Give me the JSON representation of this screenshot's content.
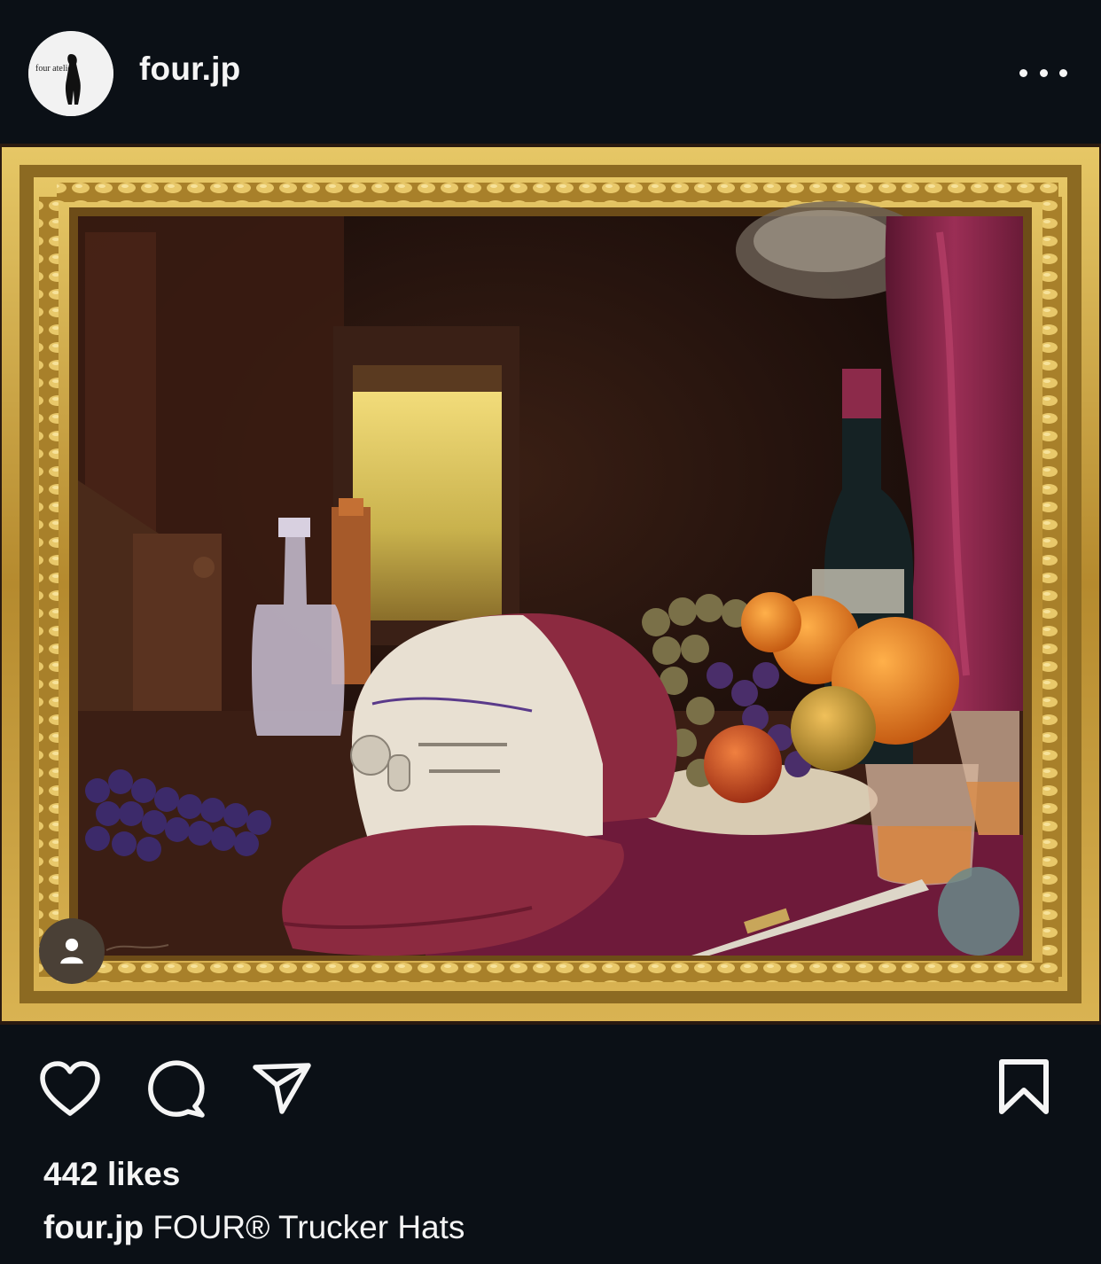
{
  "header": {
    "username": "four.jp",
    "avatar_text": "four atelier",
    "more_icon": "more-horizontal-icon"
  },
  "post": {
    "image_kind": "oil-painting-still-life",
    "tag_icon": "person-icon"
  },
  "actions": {
    "like_icon": "heart-icon",
    "comment_icon": "comment-icon",
    "share_icon": "paper-plane-icon",
    "save_icon": "bookmark-icon"
  },
  "likes_text": "442 likes",
  "caption": {
    "username": "four.jp",
    "text": "FOUR® Trucker Hats"
  },
  "colors": {
    "background": "#0b1016",
    "text": "#f5f5f5",
    "frame_gold": "#c9a441"
  }
}
